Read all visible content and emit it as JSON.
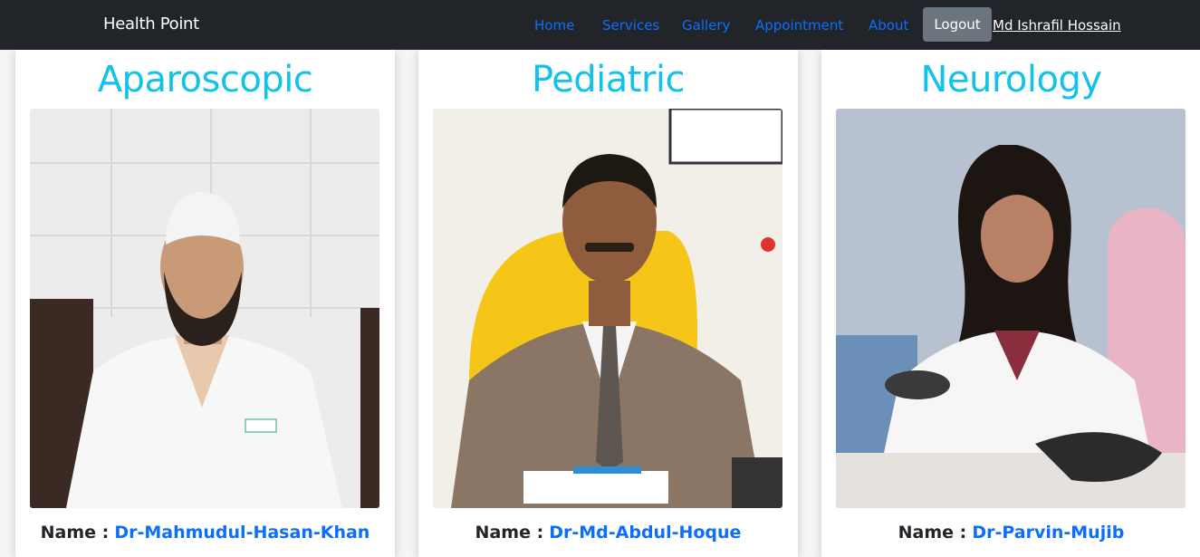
{
  "navbar": {
    "brand": "Health Point",
    "links": [
      "Home",
      "Services",
      "Gallery",
      "Appointment",
      "About"
    ],
    "logout_label": "Logout",
    "user_name": "Md Ishrafil Hossain",
    "colors": {
      "background": "#212529",
      "link": "#0d6efd",
      "logout_bg": "#6c757d"
    }
  },
  "cards": [
    {
      "specialty": "Aparoscopic",
      "name_label": "Name :",
      "doctor": "Dr-Mahmudul-Hasan-Khan"
    },
    {
      "specialty": "Pediatric",
      "name_label": "Name :",
      "doctor": "Dr-Md-Abdul-Hoque"
    },
    {
      "specialty": "Neurology",
      "name_label": "Name :",
      "doctor": "Dr-Parvin-Mujib"
    }
  ],
  "accent_color": "#13c2e8"
}
